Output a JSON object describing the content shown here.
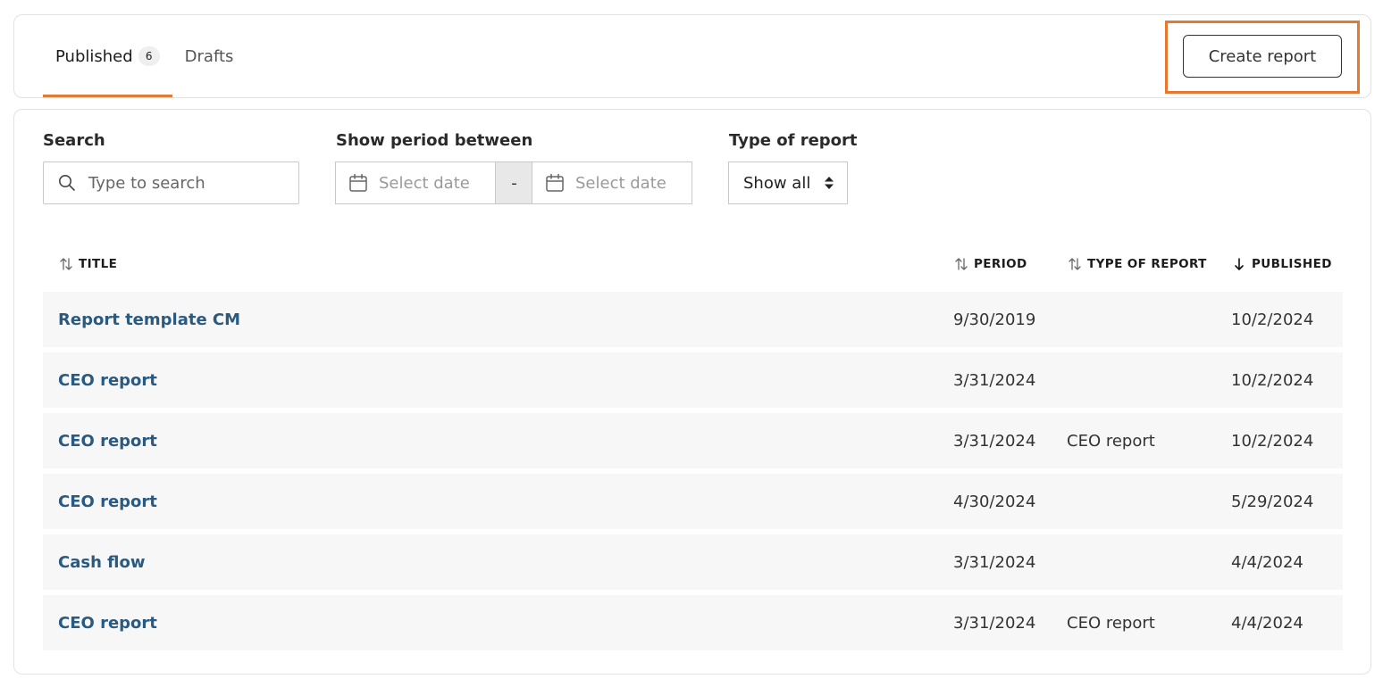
{
  "tabs": [
    {
      "label": "Published",
      "badge": "6",
      "active": true
    },
    {
      "label": "Drafts",
      "active": false
    }
  ],
  "create_button_label": "Create report",
  "filters": {
    "search_label": "Search",
    "search_placeholder": "Type to search",
    "period_label": "Show period between",
    "date_from_placeholder": "Select date",
    "date_separator": "-",
    "date_to_placeholder": "Select date",
    "type_label": "Type of report",
    "type_selected": "Show all"
  },
  "table": {
    "columns": {
      "title": "TITLE",
      "period": "PERIOD",
      "type": "TYPE OF REPORT",
      "published": "PUBLISHED"
    },
    "sort": {
      "column": "published",
      "direction": "descending"
    },
    "rows": [
      {
        "title": "Report template CM",
        "period": "9/30/2019",
        "type": "",
        "published": "10/2/2024"
      },
      {
        "title": "CEO report",
        "period": "3/31/2024",
        "type": "",
        "published": "10/2/2024"
      },
      {
        "title": "CEO report",
        "period": "3/31/2024",
        "type": "CEO report",
        "published": "10/2/2024"
      },
      {
        "title": "CEO report",
        "period": "4/30/2024",
        "type": "",
        "published": "5/29/2024"
      },
      {
        "title": "Cash flow",
        "period": "3/31/2024",
        "type": "",
        "published": "4/4/2024"
      },
      {
        "title": "CEO report",
        "period": "3/31/2024",
        "type": "CEO report",
        "published": "4/4/2024"
      }
    ]
  },
  "colors": {
    "accent": "#e07a38",
    "link": "#2b5a80",
    "row_background": "#f7f7f7"
  }
}
